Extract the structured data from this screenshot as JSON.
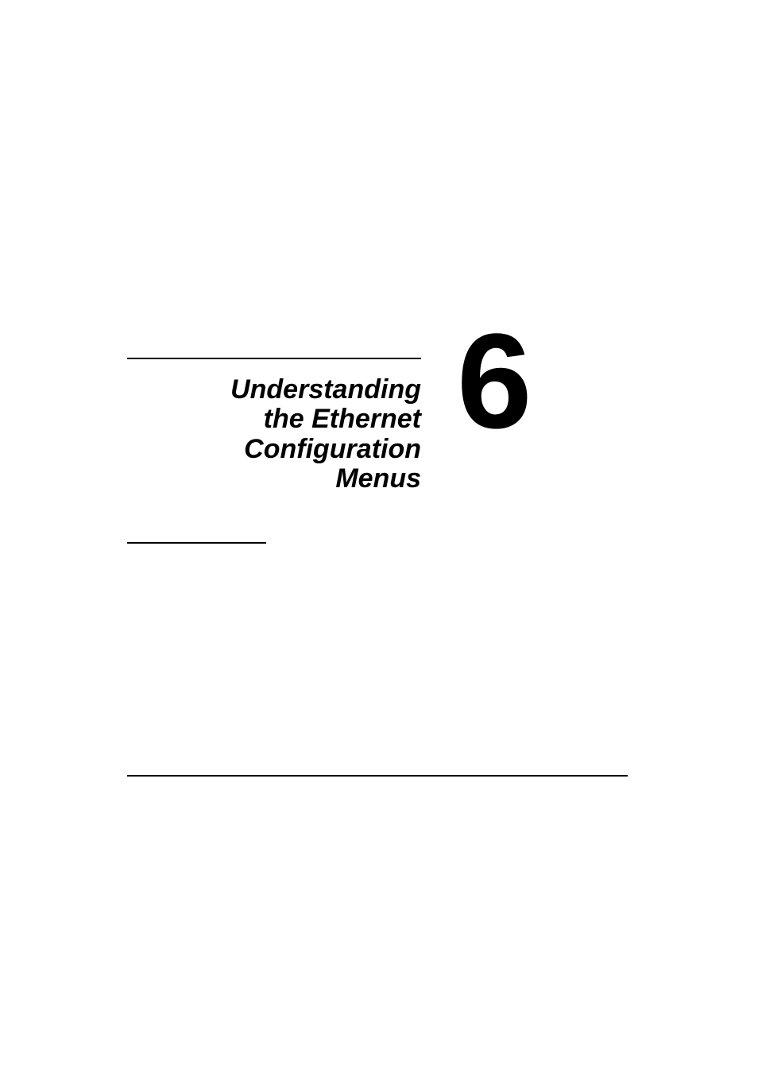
{
  "chapter": {
    "number": "6",
    "title_line1": "Understanding",
    "title_line2": "the Ethernet",
    "title_line3": "Configuration",
    "title_line4": "Menus"
  }
}
